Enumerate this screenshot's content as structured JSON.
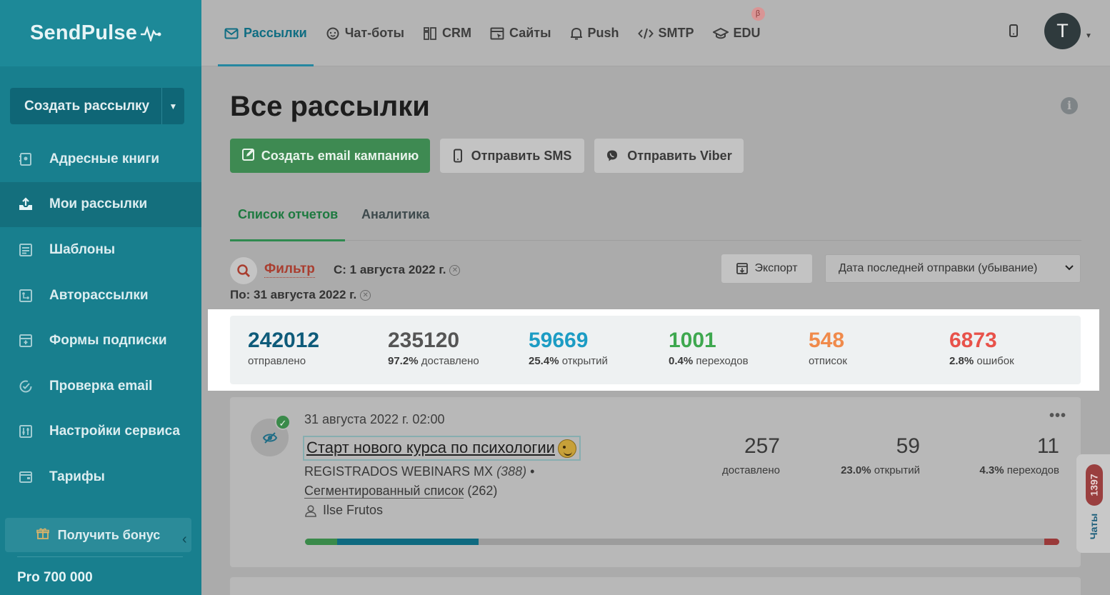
{
  "brand": {
    "name": "SendPulse"
  },
  "sidebar": {
    "create_label": "Создать рассылку",
    "items": [
      {
        "label": "Адресные книги",
        "icon": "address-book-icon"
      },
      {
        "label": "Мои рассылки",
        "icon": "upload-icon"
      },
      {
        "label": "Шаблоны",
        "icon": "template-icon"
      },
      {
        "label": "Авторассылки",
        "icon": "automation-icon"
      },
      {
        "label": "Формы подписки",
        "icon": "form-icon"
      },
      {
        "label": "Проверка email",
        "icon": "check-icon"
      },
      {
        "label": "Настройки сервиса",
        "icon": "settings-icon"
      },
      {
        "label": "Тарифы",
        "icon": "wallet-icon"
      }
    ],
    "active_index": 1,
    "bonus_label": "Получить бонус",
    "plan_label": "Pro 700 000"
  },
  "topnav": {
    "items": [
      {
        "label": "Рассылки",
        "icon": "mail-icon"
      },
      {
        "label": "Чат-боты",
        "icon": "chat-icon"
      },
      {
        "label": "CRM",
        "icon": "crm-icon"
      },
      {
        "label": "Сайты",
        "icon": "sites-icon"
      },
      {
        "label": "Push",
        "icon": "bell-icon"
      },
      {
        "label": "SMTP",
        "icon": "code-icon"
      },
      {
        "label": "EDU",
        "icon": "graduation-icon"
      }
    ],
    "beta_badge": "β",
    "avatar_letter": "T"
  },
  "page": {
    "title": "Все рассылки",
    "buttons": {
      "create_email": "Создать email кампанию",
      "send_sms": "Отправить SMS",
      "send_viber": "Отправить Viber"
    },
    "tabs": [
      "Список отчетов",
      "Аналитика"
    ],
    "filter": {
      "label": "Фильтр",
      "from": "С: 1 августа 2022 г.",
      "to": "По: 31 августа 2022 г."
    },
    "export_label": "Экспорт",
    "sort_value": "Дата последней отправки (убывание)"
  },
  "stats": [
    {
      "value": "242012",
      "pct": "",
      "label": "отправлено",
      "color": "#0e5b7a"
    },
    {
      "value": "235120",
      "pct": "97.2%",
      "label": "доставлено",
      "color": "#555555"
    },
    {
      "value": "59669",
      "pct": "25.4%",
      "label": "открытий",
      "color": "#1c9cc4"
    },
    {
      "value": "1001",
      "pct": "0.4%",
      "label": "переходов",
      "color": "#3ea84f"
    },
    {
      "value": "548",
      "pct": "",
      "label": "отписок",
      "color": "#f08a4b"
    },
    {
      "value": "6873",
      "pct": "2.8%",
      "label": "ошибок",
      "color": "#e8524a"
    }
  ],
  "campaign": {
    "date": "31 августа 2022 г. 02:00",
    "title": "Старт нового курса по психологии",
    "list_name": "REGISTRADOS WEBINARS MX",
    "list_count": "(388)",
    "segment_name": "Сегментированный список",
    "segment_count": "(262)",
    "author": "Ilse Frutos",
    "stats": [
      {
        "value": "257",
        "pct": "",
        "label": "доставлено"
      },
      {
        "value": "59",
        "pct": "23.0%",
        "label": "открытий"
      },
      {
        "value": "11",
        "pct": "4.3%",
        "label": "переходов"
      }
    ],
    "progress": {
      "delivered_pct": 4.3,
      "opened_pct": 18.7,
      "error_pct": 2.0
    }
  },
  "chat": {
    "count": "1397",
    "label": "Чаты"
  }
}
